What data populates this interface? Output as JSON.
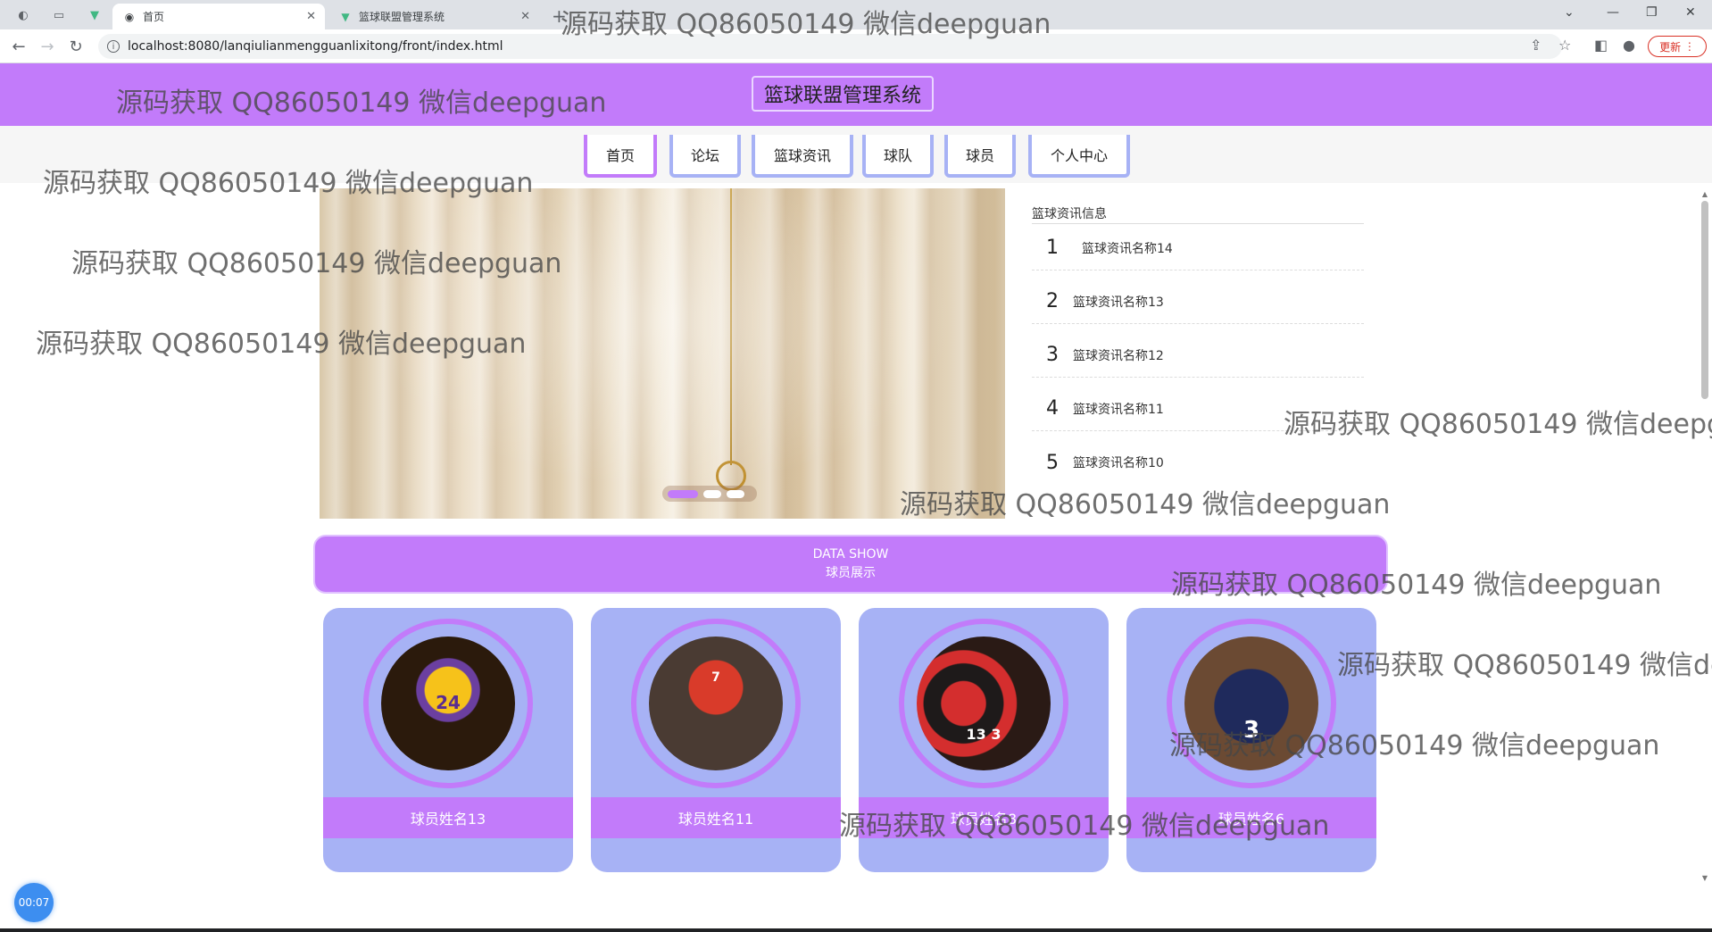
{
  "browser": {
    "tabs": [
      {
        "title": "首页",
        "active": true
      },
      {
        "title": "篮球联盟管理系统",
        "active": false
      }
    ],
    "url": "localhost:8080/lanqiulianmengguanlixitong/front/index.html",
    "update_label": "更新"
  },
  "site": {
    "title": "篮球联盟管理系统",
    "accent_color": "#c27bfa",
    "card_color": "#a7b2f5"
  },
  "nav": {
    "items": [
      {
        "label": "首页",
        "active": true
      },
      {
        "label": "论坛",
        "active": false
      },
      {
        "label": "篮球资讯",
        "active": false
      },
      {
        "label": "球队",
        "active": false
      },
      {
        "label": "球员",
        "active": false
      },
      {
        "label": "个人中心",
        "active": false
      }
    ]
  },
  "news": {
    "title": "篮球资讯信息",
    "items": [
      {
        "num": "1",
        "name": "篮球资讯名称14"
      },
      {
        "num": "2",
        "name": "篮球资讯名称13"
      },
      {
        "num": "3",
        "name": "篮球资讯名称12"
      },
      {
        "num": "4",
        "name": "篮球资讯名称11"
      },
      {
        "num": "5",
        "name": "篮球资讯名称10"
      }
    ]
  },
  "section": {
    "title_en": "DATA SHOW",
    "title_cn": "球员展示"
  },
  "players": [
    {
      "name": "球员姓名13",
      "jersey": "24"
    },
    {
      "name": "球员姓名11",
      "jersey": "7"
    },
    {
      "name": "球员姓名8",
      "jersey": "13 3"
    },
    {
      "name": "球员姓名6",
      "jersey": "3"
    }
  ],
  "timer": "00:07",
  "watermark": "源码获取 QQ86050149 微信deepguan"
}
